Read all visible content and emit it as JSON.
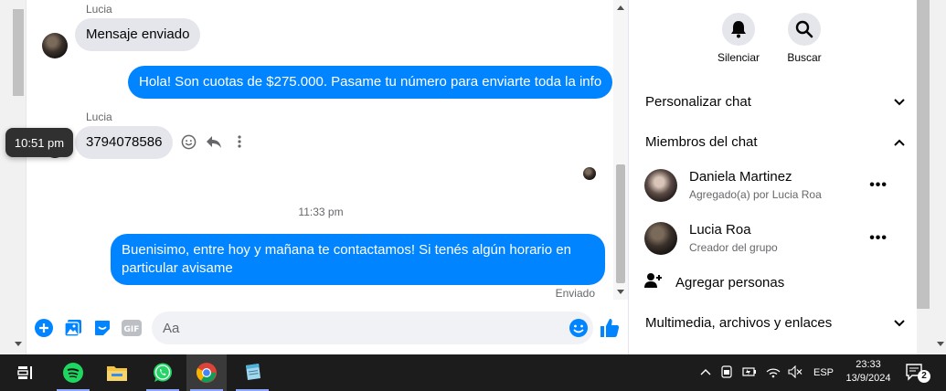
{
  "colors": {
    "accent": "#0084ff",
    "incoming_bubble": "#e4e6eb",
    "taskbar": "#1c1c1c"
  },
  "conversation": {
    "messages": [
      {
        "sender": "Lucia",
        "text": "Mensaje enviado",
        "direction": "incoming"
      },
      {
        "text": "Hola! Son cuotas de $275.000. Pasame tu número para enviarte toda la info",
        "direction": "outgoing"
      },
      {
        "sender": "Lucia",
        "text": "3794078586",
        "direction": "incoming"
      },
      {
        "text": "Buenisimo, entre hoy y mañana te contactamos! Si tenés algún horario en particular avisame",
        "direction": "outgoing"
      }
    ],
    "hover_tooltip": "10:51 pm",
    "time_separator": "11:33 pm",
    "status": "Enviado"
  },
  "composer": {
    "placeholder": "Aa"
  },
  "info_panel": {
    "actions": [
      {
        "label": "Silenciar",
        "icon": "bell-icon"
      },
      {
        "label": "Buscar",
        "icon": "search-icon"
      }
    ],
    "sections": {
      "customize": "Personalizar chat",
      "members": "Miembros del chat",
      "media": "Multimedia, archivos y enlaces"
    },
    "members": [
      {
        "name": "Daniela Martinez",
        "subtitle": "Agregado(a) por Lucia Roa"
      },
      {
        "name": "Lucia Roa",
        "subtitle": "Creador del grupo"
      }
    ],
    "add_people": "Agregar personas"
  },
  "taskbar": {
    "apps": [
      "task-view",
      "spotify",
      "file-explorer",
      "whatsapp",
      "chrome",
      "notepad"
    ],
    "language": "ESP",
    "time": "23:33",
    "date": "13/9/2024",
    "notification_count": "2"
  }
}
